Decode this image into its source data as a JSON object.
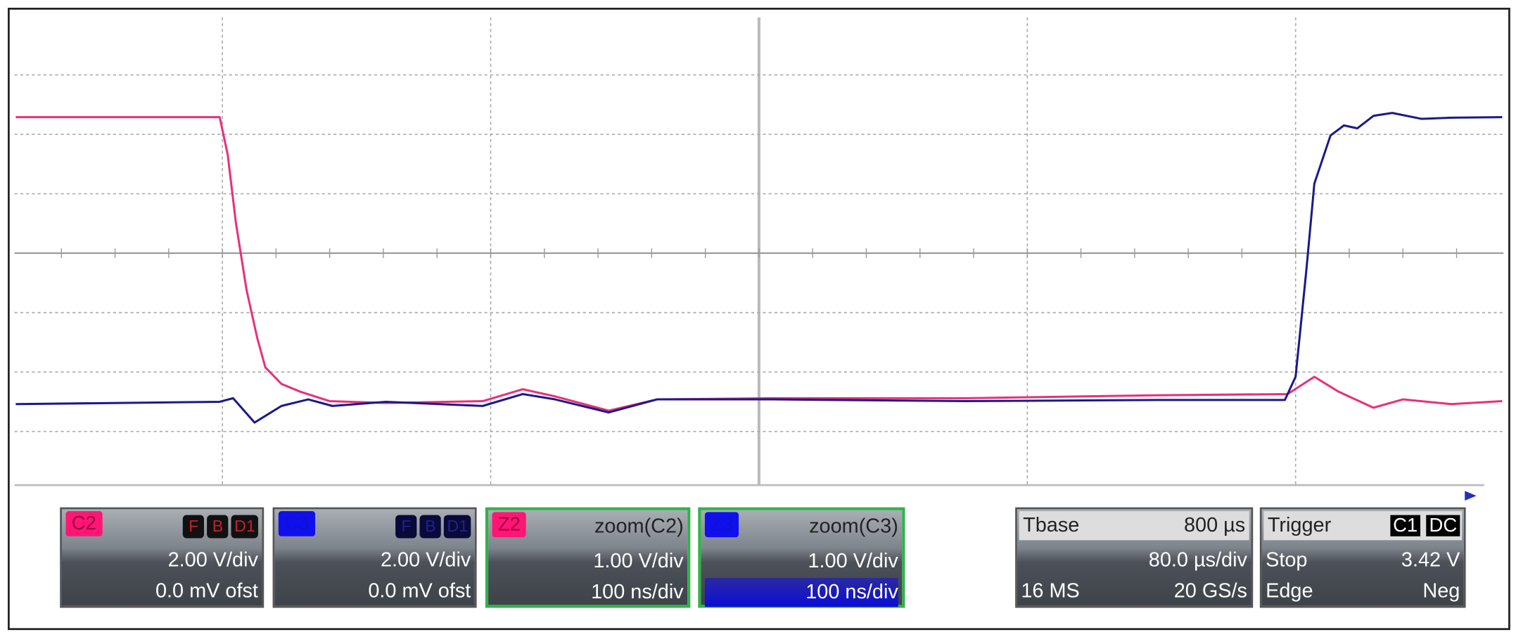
{
  "channels": [
    {
      "badge": "C2",
      "flags": [
        "F",
        "B",
        "D1"
      ],
      "vdiv": "2.00 V/div",
      "offset": "0.0 mV ofst",
      "color": "#ff1675"
    },
    {
      "badge": "C3",
      "flags": [
        "F",
        "B",
        "D1"
      ],
      "vdiv": "2.00 V/div",
      "offset": "0.0 mV ofst",
      "color": "#1010ee"
    }
  ],
  "zooms": [
    {
      "badge": "Z2",
      "source": "zoom(C2)",
      "vdiv": "1.00 V/div",
      "tdiv": "100 ns/div"
    },
    {
      "badge": "Z3",
      "source": "zoom(C3)",
      "vdiv": "1.00 V/div",
      "tdiv": "100 ns/div"
    }
  ],
  "timebase": {
    "label": "Tbase",
    "delay": "800 µs",
    "tdiv": "80.0 µs/div",
    "samples": "16 MS",
    "rate": "20 GS/s"
  },
  "trigger": {
    "label": "Trigger",
    "source": "C1",
    "coupling": "DC",
    "mode": "Stop",
    "level": "3.42 V",
    "type": "Edge",
    "slope": "Neg"
  },
  "chart_data": {
    "type": "line",
    "units": "divisions from screen center",
    "xlim": [
      -2.77,
      2.77
    ],
    "ylim": [
      -3.9,
      3.9
    ],
    "grid": true,
    "series": [
      {
        "name": "Z2 zoom(C2)",
        "color": "#e8307a",
        "x": [
          -2.77,
          -2.01,
          -1.98,
          -1.95,
          -1.91,
          -1.87,
          -1.84,
          -1.78,
          -1.71,
          -1.6,
          -1.39,
          -1.03,
          -0.88,
          -0.76,
          -0.56,
          -0.38,
          0.05,
          0.77,
          1.49,
          1.97,
          2.07,
          2.16,
          2.29,
          2.4,
          2.58,
          2.77
        ],
        "y": [
          2.29,
          2.29,
          1.66,
          0.52,
          -0.62,
          -1.43,
          -1.92,
          -2.2,
          -2.33,
          -2.49,
          -2.52,
          -2.49,
          -2.29,
          -2.41,
          -2.65,
          -2.46,
          -2.44,
          -2.44,
          -2.39,
          -2.37,
          -2.08,
          -2.33,
          -2.6,
          -2.46,
          -2.54,
          -2.49
        ]
      },
      {
        "name": "Z3 zoom(C3)",
        "color": "#1a1a8a",
        "x": [
          -2.77,
          -2.01,
          -1.96,
          -1.88,
          -1.78,
          -1.68,
          -1.59,
          -1.39,
          -1.03,
          -0.88,
          -0.76,
          -0.56,
          -0.38,
          0.05,
          0.77,
          1.49,
          1.96,
          2.0,
          2.04,
          2.07,
          2.13,
          2.18,
          2.23,
          2.29,
          2.36,
          2.47,
          2.58,
          2.77
        ],
        "y": [
          -2.54,
          -2.5,
          -2.44,
          -2.85,
          -2.57,
          -2.46,
          -2.57,
          -2.5,
          -2.57,
          -2.37,
          -2.46,
          -2.68,
          -2.46,
          -2.46,
          -2.49,
          -2.47,
          -2.47,
          -2.08,
          -0.29,
          1.17,
          1.98,
          2.15,
          2.1,
          2.31,
          2.36,
          2.26,
          2.28,
          2.29
        ]
      }
    ]
  }
}
